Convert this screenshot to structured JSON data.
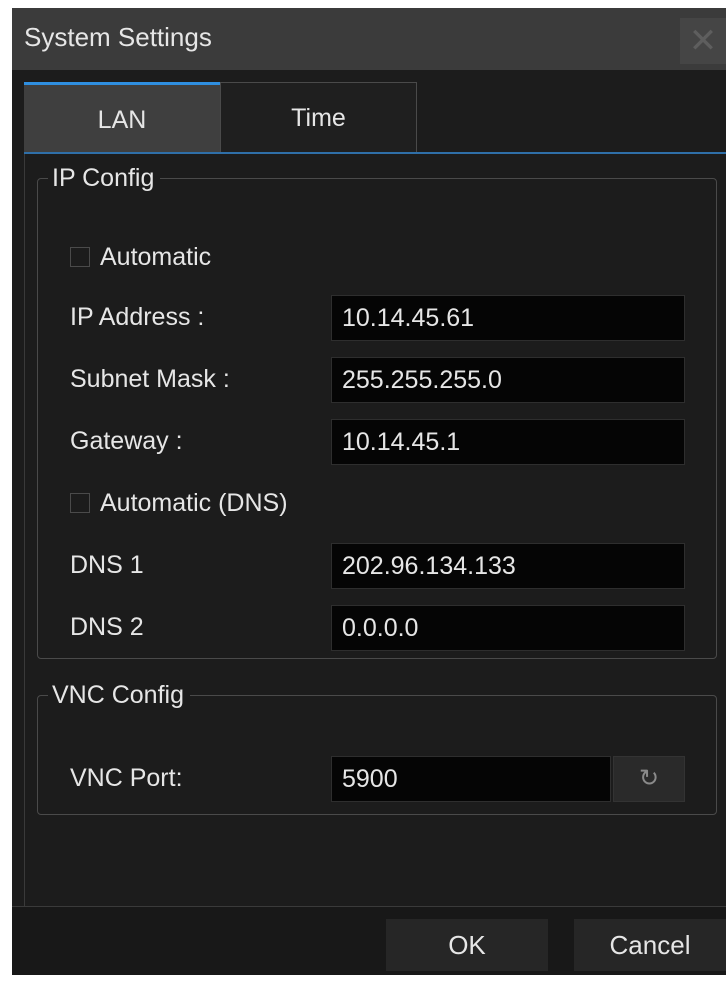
{
  "window": {
    "title": "System Settings",
    "close_glyph": "✕"
  },
  "tabs": [
    {
      "label": "LAN",
      "active": true
    },
    {
      "label": "Time",
      "active": false
    }
  ],
  "ip_config": {
    "legend": "IP Config",
    "automatic": {
      "label": "Automatic",
      "checked": false
    },
    "ip_address": {
      "label": "IP Address :",
      "value": "10.14.45.61"
    },
    "subnet_mask": {
      "label": "Subnet Mask :",
      "value": "255.255.255.0"
    },
    "gateway": {
      "label": "Gateway :",
      "value": "10.14.45.1"
    },
    "automatic_dns": {
      "label": "Automatic (DNS)",
      "checked": false
    },
    "dns1": {
      "label": "DNS 1",
      "value": "202.96.134.133"
    },
    "dns2": {
      "label": "DNS 2",
      "value": "0.0.0.0"
    }
  },
  "vnc_config": {
    "legend": "VNC Config",
    "port": {
      "label": "VNC Port:",
      "value": "5900"
    },
    "reset_icon": "refresh-icon",
    "reset_glyph": "↻"
  },
  "buttons": {
    "ok": "OK",
    "cancel": "Cancel"
  },
  "colors": {
    "accent": "#2f8fe0",
    "background": "#1c1c1c",
    "field_bg": "#050505",
    "text": "#e6e6e6"
  }
}
